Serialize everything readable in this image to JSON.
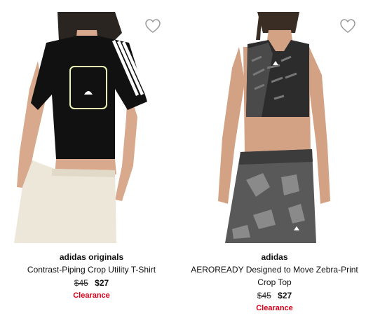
{
  "products": [
    {
      "brand": "adidas originals",
      "name": "Contrast-Piping Crop Utility T-Shirt",
      "was_price": "$45",
      "now_price": "$27",
      "badge": "Clearance",
      "image_icon": "product-photo"
    },
    {
      "brand": "adidas",
      "name": "AEROREADY Designed to Move Zebra-Print Crop Top",
      "was_price": "$45",
      "now_price": "$27",
      "badge": "Clearance",
      "image_icon": "product-photo"
    }
  ],
  "icons": {
    "favorite": "heart-outline-icon"
  },
  "colors": {
    "clearance": "#d4001a",
    "heart_stroke": "#9a9a9a"
  }
}
